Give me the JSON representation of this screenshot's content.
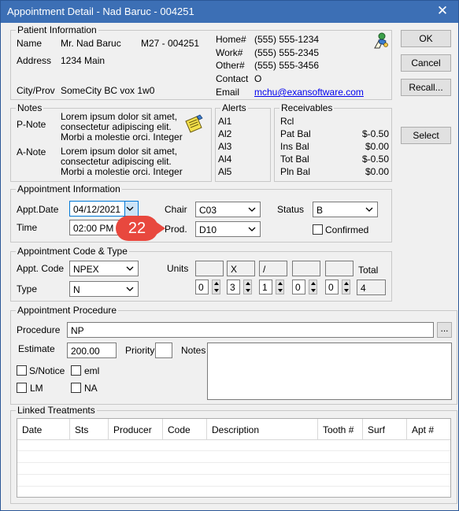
{
  "window": {
    "title": "Appointment Detail - Nad Baruc - 004251",
    "close_glyph": "✕"
  },
  "buttons": {
    "ok": "OK",
    "cancel": "Cancel",
    "recall": "Recall...",
    "select": "Select",
    "browse": "..."
  },
  "patient": {
    "section_title": "Patient Information",
    "name_label": "Name",
    "name": "Mr. Nad Baruc",
    "sex_age": "M27 - 004251",
    "address_label": "Address",
    "address": "1234 Main",
    "city_label": "City/Prov",
    "city": "SomeCity BC vox 1w0",
    "home_label": "Home#",
    "home": "(555) 555-1234",
    "work_label": "Work#",
    "work": "(555) 555-2345",
    "other_label": "Other#",
    "other": "(555) 555-3456",
    "contact_label": "Contact",
    "contact": "O",
    "email_label": "Email",
    "email": "mchu@exansoftware.com"
  },
  "notes": {
    "section_title": "Notes",
    "pnote_label": "P-Note",
    "pnote": "Lorem ipsum dolor sit amet, consectetur adipiscing elit. Morbi a molestie orci. Integer",
    "anote_label": "A-Note",
    "anote": "Lorem ipsum dolor sit amet, consectetur adipiscing elit. Morbi a molestie orci. Integer"
  },
  "alerts": {
    "section_title": "Alerts",
    "items": [
      "Al1",
      "Al2",
      "Al3",
      "Al4",
      "Al5"
    ]
  },
  "receivables": {
    "section_title": "Receivables",
    "rcl_label": "Rcl",
    "rows": [
      {
        "label": "Pat Bal",
        "value": "$-0.50"
      },
      {
        "label": "Ins Bal",
        "value": "$0.00"
      },
      {
        "label": "Tot Bal",
        "value": "$-0.50"
      },
      {
        "label": "Pln Bal",
        "value": "$0.00"
      }
    ]
  },
  "appointment": {
    "section_title": "Appointment Information",
    "date_label": "Appt.Date",
    "date": "04/12/2021",
    "time_label": "Time",
    "time": "02:00 PM",
    "chair_label": "Chair",
    "chair": "C03",
    "prod_label": "Prod.",
    "prod": "D10",
    "status_label": "Status",
    "status": "B",
    "confirmed_label": "Confirmed",
    "confirmed": false
  },
  "callout": {
    "number": "22"
  },
  "code_type": {
    "section_title": "Appointment Code & Type",
    "code_label": "Appt. Code",
    "code": "NPEX",
    "type_label": "Type",
    "type": "N",
    "units_label": "Units",
    "units_top": [
      "",
      "X",
      "/",
      "",
      ""
    ],
    "units_vals": [
      "0",
      "3",
      "1",
      "0",
      "0"
    ],
    "total_label": "Total",
    "total": "4"
  },
  "procedure": {
    "section_title": "Appointment Procedure",
    "procedure_label": "Procedure",
    "procedure": "NP",
    "estimate_label": "Estimate",
    "estimate": "200.00",
    "priority_label": "Priority",
    "priority": "",
    "notes_label": "Notes",
    "notes": "",
    "checks": [
      {
        "label": "S/Notice",
        "checked": false
      },
      {
        "label": "eml",
        "checked": false
      },
      {
        "label": "LM",
        "checked": false
      },
      {
        "label": "NA",
        "checked": false
      }
    ]
  },
  "linked": {
    "section_title": "Linked Treatments",
    "columns": [
      "Date",
      "Sts",
      "Producer",
      "Code",
      "Description",
      "Tooth #",
      "Surf",
      "Apt #"
    ]
  },
  "colors": {
    "titlebar": "#3c6fb5",
    "callout": "#e8483e",
    "link": "#0000ee"
  },
  "icons": {
    "patient": "person-ribbon-icon",
    "notes": "sticky-note-icon"
  }
}
